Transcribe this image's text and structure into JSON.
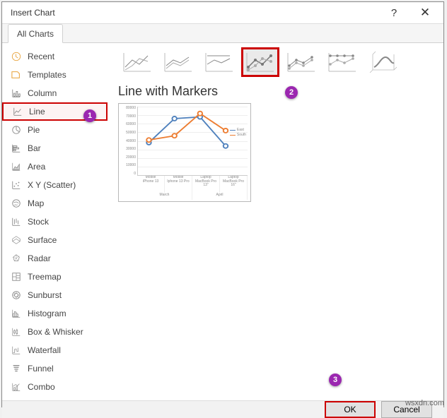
{
  "dialog": {
    "title": "Insert Chart",
    "help_icon": "?",
    "close_icon": "✕"
  },
  "tabs": {
    "active": "All Charts"
  },
  "sidebar": {
    "items": [
      {
        "label": "Recent"
      },
      {
        "label": "Templates"
      },
      {
        "label": "Column"
      },
      {
        "label": "Line",
        "selected": true
      },
      {
        "label": "Pie"
      },
      {
        "label": "Bar"
      },
      {
        "label": "Area"
      },
      {
        "label": "X Y (Scatter)"
      },
      {
        "label": "Map"
      },
      {
        "label": "Stock"
      },
      {
        "label": "Surface"
      },
      {
        "label": "Radar"
      },
      {
        "label": "Treemap"
      },
      {
        "label": "Sunburst"
      },
      {
        "label": "Histogram"
      },
      {
        "label": "Box & Whisker"
      },
      {
        "label": "Waterfall"
      },
      {
        "label": "Funnel"
      },
      {
        "label": "Combo"
      }
    ]
  },
  "subtypes": {
    "selected_index": 3,
    "count": 7
  },
  "preview": {
    "title": "Line with Markers"
  },
  "chart_data": {
    "type": "line",
    "title": "",
    "y_ticks": [
      "80000",
      "70000",
      "60000",
      "50000",
      "40000",
      "30000",
      "20000",
      "10000",
      "0"
    ],
    "ylim": [
      0,
      80000
    ],
    "x_categories": [
      {
        "label": "Mobile",
        "sub": "iPhone 13",
        "group": "March"
      },
      {
        "label": "Mobile",
        "sub": "Iphone 13 Pro",
        "group": "March"
      },
      {
        "label": "Laptop",
        "sub": "MacBook Pro 13\"",
        "group": "April"
      },
      {
        "label": "Laptop",
        "sub": "MacBook Pro 16\"",
        "group": "April"
      }
    ],
    "x_groups": [
      "March",
      "April"
    ],
    "series": [
      {
        "name": "East",
        "color": "#4f81bd",
        "values": [
          38000,
          66000,
          68000,
          34000
        ]
      },
      {
        "name": "South",
        "color": "#ed7d31",
        "values": [
          41000,
          46000,
          72000,
          52000
        ]
      }
    ]
  },
  "footer": {
    "ok": "OK",
    "cancel": "Cancel"
  },
  "annotations": {
    "b1": "1",
    "b2": "2",
    "b3": "3"
  },
  "watermark": "wsxdn.com"
}
